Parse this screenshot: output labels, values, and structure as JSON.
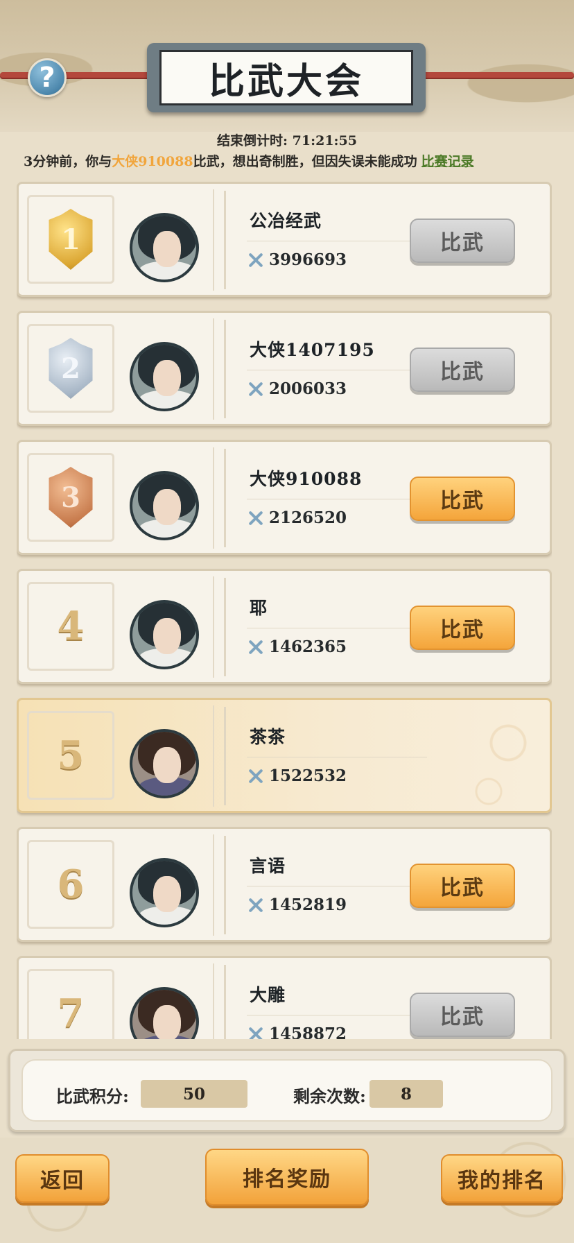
{
  "header": {
    "title": "比武大会",
    "help_label": "?"
  },
  "countdown": {
    "label": "结束倒计时:",
    "value": "71:21:55"
  },
  "notice": {
    "prefix": "3分钟前，你与",
    "opponent": "大侠910088",
    "suffix": "比武，想出奇制胜，但因失误未能成功",
    "record_link": "比赛记录"
  },
  "ranking": [
    {
      "rank": "1",
      "medal": "gold",
      "name": "公冶经武",
      "power": "3996693",
      "button": "比武",
      "button_state": "disabled",
      "avatar": "male-avatar"
    },
    {
      "rank": "2",
      "medal": "silver",
      "name": "大侠1407195",
      "power": "2006033",
      "button": "比武",
      "button_state": "disabled",
      "avatar": "male-avatar"
    },
    {
      "rank": "3",
      "medal": "bronze",
      "name": "大侠910088",
      "power": "2126520",
      "button": "比武",
      "button_state": "active",
      "avatar": "male-avatar"
    },
    {
      "rank": "4",
      "medal": "",
      "name": "耶",
      "power": "1462365",
      "button": "比武",
      "button_state": "active",
      "avatar": "male-avatar"
    },
    {
      "rank": "5",
      "medal": "",
      "name": "茶茶",
      "power": "1522532",
      "button": "",
      "button_state": "self",
      "avatar": "female-avatar"
    },
    {
      "rank": "6",
      "medal": "",
      "name": "言语",
      "power": "1452819",
      "button": "比武",
      "button_state": "active",
      "avatar": "male-avatar"
    },
    {
      "rank": "7",
      "medal": "",
      "name": "大雕",
      "power": "1458872",
      "button": "比武",
      "button_state": "disabled",
      "avatar": "female-avatar"
    }
  ],
  "stats": {
    "score_label": "比武积分:",
    "score_value": "50",
    "remaining_label": "剩余次数:",
    "remaining_value": "8"
  },
  "footer": {
    "back_label": "返回",
    "reward_label": "排名奖励",
    "my_rank_label": "我的排名"
  },
  "colors": {
    "accent_orange": "#f4a53b",
    "opponent_name": "#f1a53c",
    "record_link": "#4c7a27",
    "rope": "#b4483c"
  }
}
